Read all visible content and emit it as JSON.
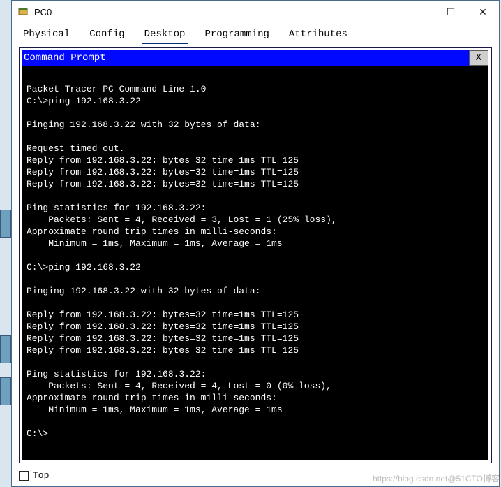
{
  "window": {
    "title": "PC0",
    "min": "—",
    "max": "☐",
    "close": "✕"
  },
  "tabs": {
    "physical": "Physical",
    "config": "Config",
    "desktop": "Desktop",
    "programming": "Programming",
    "attributes": "Attributes"
  },
  "prompt_panel": {
    "title": "Command Prompt",
    "close": "X"
  },
  "terminal": {
    "lines": [
      "",
      "Packet Tracer PC Command Line 1.0",
      "C:\\>ping 192.168.3.22",
      "",
      "Pinging 192.168.3.22 with 32 bytes of data:",
      "",
      "Request timed out.",
      "Reply from 192.168.3.22: bytes=32 time=1ms TTL=125",
      "Reply from 192.168.3.22: bytes=32 time=1ms TTL=125",
      "Reply from 192.168.3.22: bytes=32 time=1ms TTL=125",
      "",
      "Ping statistics for 192.168.3.22:",
      "    Packets: Sent = 4, Received = 3, Lost = 1 (25% loss),",
      "Approximate round trip times in milli-seconds:",
      "    Minimum = 1ms, Maximum = 1ms, Average = 1ms",
      "",
      "C:\\>ping 192.168.3.22",
      "",
      "Pinging 192.168.3.22 with 32 bytes of data:",
      "",
      "Reply from 192.168.3.22: bytes=32 time=1ms TTL=125",
      "Reply from 192.168.3.22: bytes=32 time=1ms TTL=125",
      "Reply from 192.168.3.22: bytes=32 time=1ms TTL=125",
      "Reply from 192.168.3.22: bytes=32 time=1ms TTL=125",
      "",
      "Ping statistics for 192.168.3.22:",
      "    Packets: Sent = 4, Received = 4, Lost = 0 (0% loss),",
      "Approximate round trip times in milli-seconds:",
      "    Minimum = 1ms, Maximum = 1ms, Average = 1ms",
      "",
      "C:\\>"
    ]
  },
  "footer": {
    "top_label": "Top"
  },
  "watermark": "https://blog.csdn.net@51CTO博客"
}
